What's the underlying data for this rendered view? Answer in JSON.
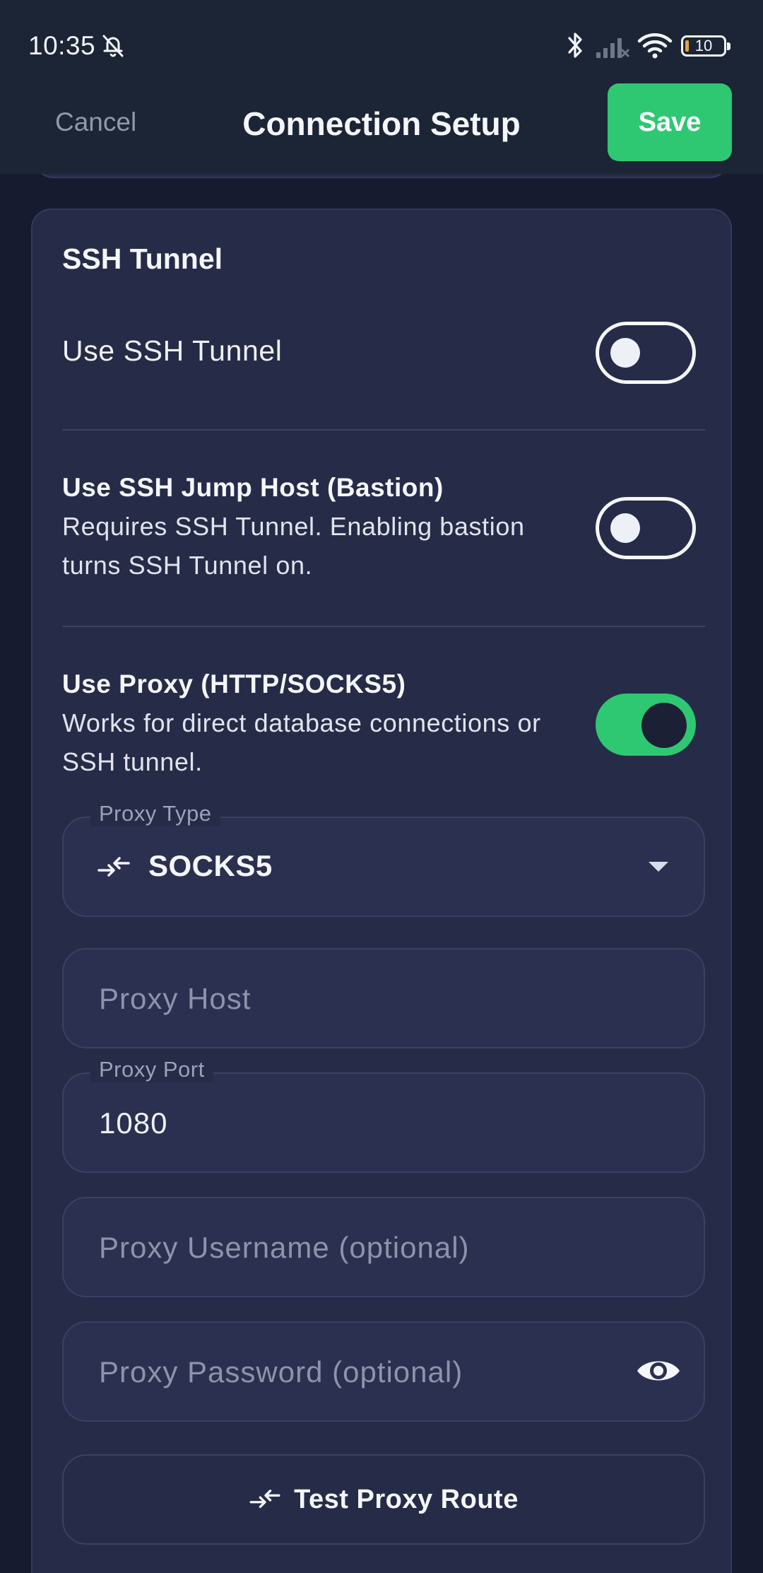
{
  "status_bar": {
    "time": "10:35",
    "battery": "10",
    "icons": [
      "bell-off-icon",
      "bluetooth-icon",
      "signal-icon",
      "wifi-icon",
      "battery-icon"
    ]
  },
  "app_bar": {
    "cancel_label": "Cancel",
    "title": "Connection Setup",
    "save_label": "Save"
  },
  "colors": {
    "accent": "#2ec872",
    "background": "#171b30",
    "card": "#262b47",
    "topbar": "#1b2535"
  },
  "ssh_card": {
    "title": "SSH Tunnel",
    "use_ssh_tunnel": {
      "label": "Use SSH Tunnel",
      "enabled": false
    },
    "use_jump_host": {
      "title": "Use SSH Jump Host (Bastion)",
      "subtitle": "Requires SSH Tunnel. Enabling bastion turns SSH Tunnel on.",
      "enabled": false
    },
    "use_proxy": {
      "title": "Use Proxy (HTTP/SOCKS5)",
      "subtitle": "Works for direct database connections or SSH tunnel.",
      "enabled": true
    },
    "proxy_type": {
      "label": "Proxy Type",
      "value": "SOCKS5",
      "icon": "swap-icon"
    },
    "proxy_host": {
      "placeholder": "Proxy Host",
      "value": ""
    },
    "proxy_port": {
      "label": "Proxy Port",
      "value": "1080"
    },
    "proxy_username": {
      "placeholder": "Proxy Username (optional)",
      "value": ""
    },
    "proxy_password": {
      "placeholder": "Proxy Password (optional)",
      "value": "",
      "icon": "eye-icon"
    },
    "test_button": {
      "label": "Test Proxy Route",
      "icon": "swap-icon"
    }
  }
}
